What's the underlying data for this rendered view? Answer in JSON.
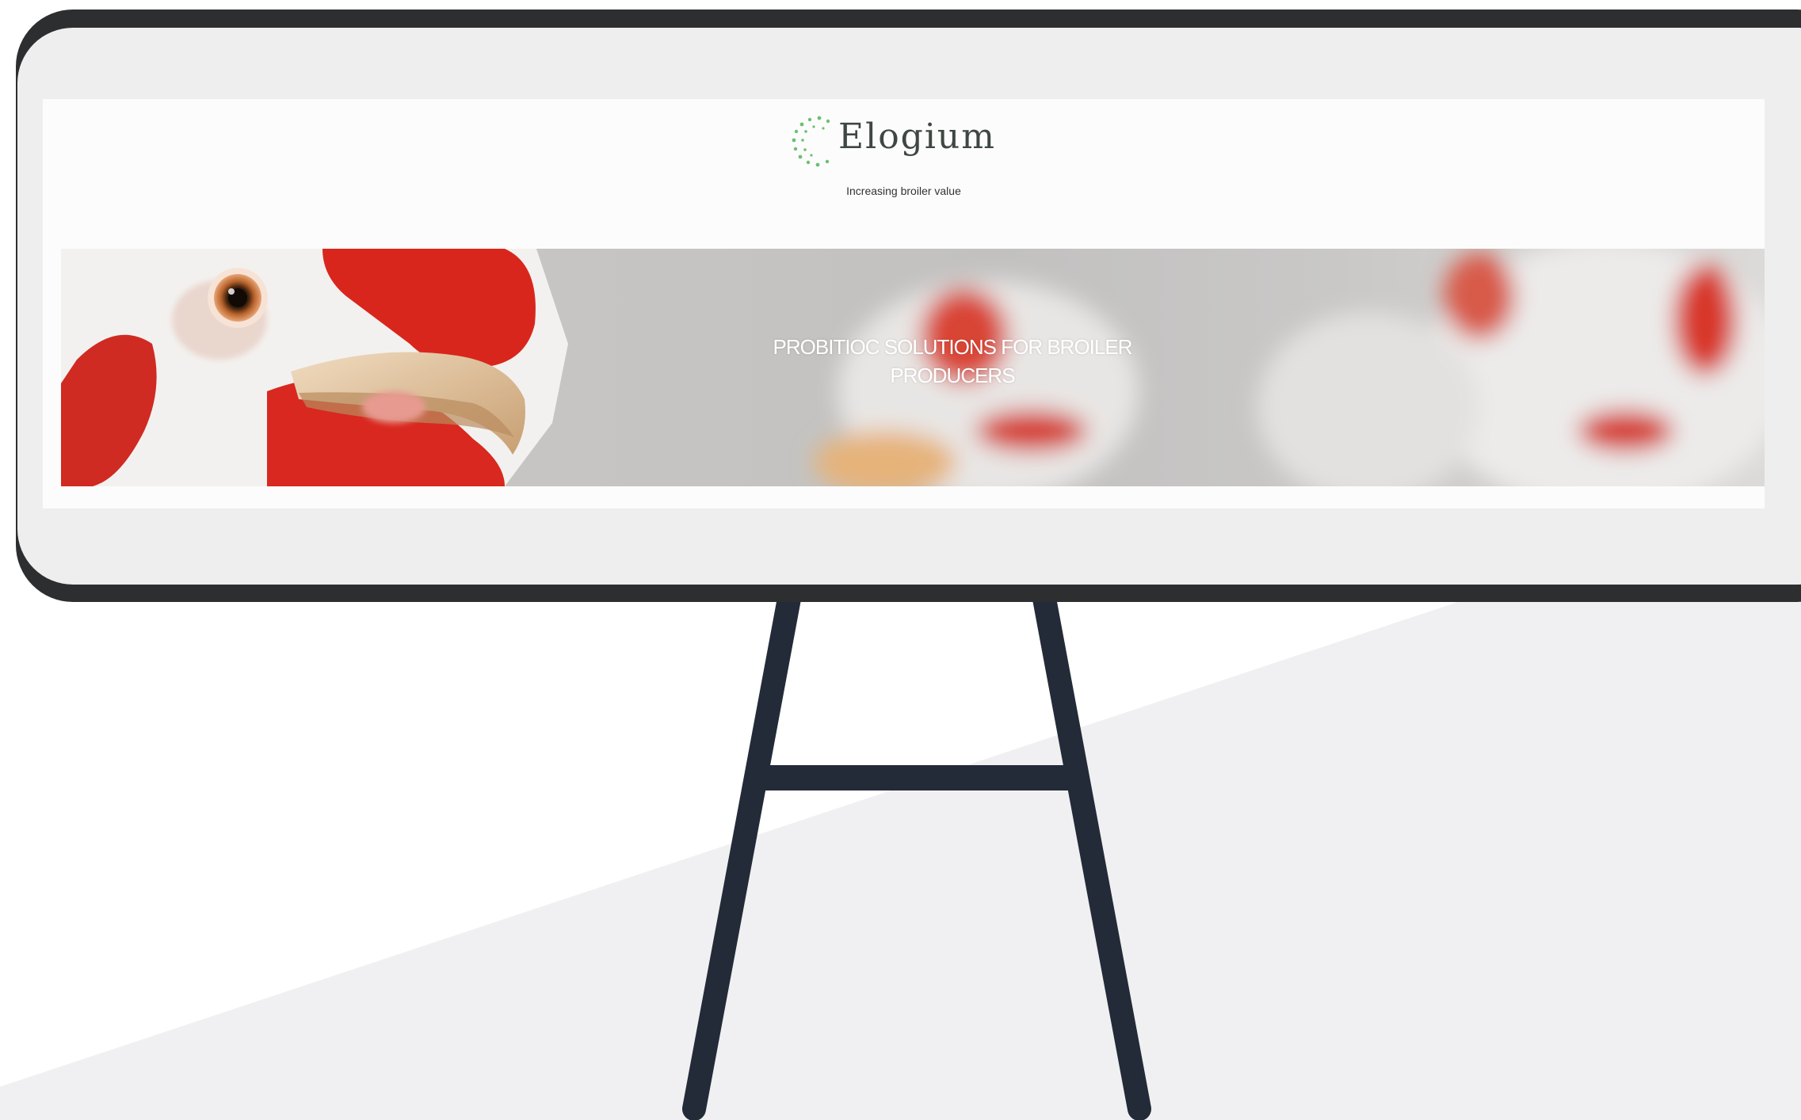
{
  "scene": {
    "colors": {
      "frame": "#2d2e30",
      "board": "#eeeeee",
      "stand": "#232b38",
      "floor": "#f0f0f2"
    }
  },
  "website": {
    "brand": {
      "name": "Elogium",
      "tagline": "Increasing broiler value",
      "logo_icon": "dotted-circle-icon",
      "accent_color": "#6cc071"
    },
    "hero": {
      "title": "PROBITIOC SOLUTIONS FOR BROILER PRODUCERS",
      "image": "broiler-chickens-photo"
    }
  }
}
